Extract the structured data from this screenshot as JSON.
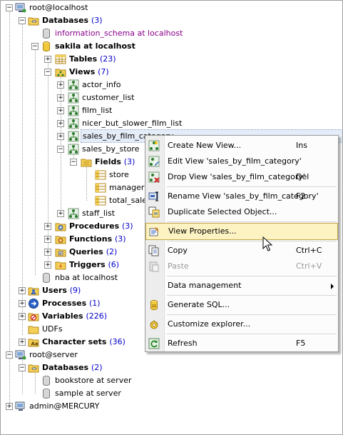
{
  "tree": {
    "root_localhost": "root@localhost",
    "databases": "Databases",
    "databases_count": "(3)",
    "information_schema": "information_schema at localhost",
    "sakila": "sakila at localhost",
    "tables": "Tables",
    "tables_count": "(23)",
    "views": "Views",
    "views_count": "(7)",
    "view_items": [
      "actor_info",
      "customer_list",
      "film_list",
      "nicer_but_slower_film_list",
      "sales_by_film_category",
      "sales_by_store"
    ],
    "fields": "Fields",
    "fields_count": "(3)",
    "field_items": [
      "store",
      "manager",
      "total_sales"
    ],
    "staff_list": "staff_list",
    "procedures": "Procedures",
    "procedures_count": "(3)",
    "functions": "Functions",
    "functions_count": "(3)",
    "queries": "Queries",
    "queries_count": "(2)",
    "triggers": "Triggers",
    "triggers_count": "(6)",
    "nba": "nba at localhost",
    "users": "Users",
    "users_count": "(9)",
    "processes": "Processes",
    "processes_count": "(1)",
    "variables": "Variables",
    "variables_count": "(226)",
    "udfs": "UDFs",
    "charsets": "Character sets",
    "charsets_count": "(36)",
    "root_server": "root@server",
    "server_databases": "Databases",
    "server_databases_count": "(2)",
    "bookstore": "bookstore at server",
    "sample": "sample at server",
    "admin_mercury": "admin@MERCURY"
  },
  "context_menu": {
    "create_view": {
      "label": "Create New View...",
      "shortcut": "Ins"
    },
    "edit_view": {
      "label": "Edit View 'sales_by_film_category'",
      "shortcut": ""
    },
    "drop_view": {
      "label": "Drop View 'sales_by_film_category'",
      "shortcut": "Del"
    },
    "rename_view": {
      "label": "Rename View 'sales_by_film_category'",
      "shortcut": "F2"
    },
    "duplicate": {
      "label": "Duplicate Selected Object...",
      "shortcut": ""
    },
    "view_properties": {
      "label": "View Properties...",
      "shortcut": ""
    },
    "copy": {
      "label": "Copy",
      "shortcut": "Ctrl+C"
    },
    "paste": {
      "label": "Paste",
      "shortcut": "Ctrl+V"
    },
    "data_management": {
      "label": "Data management",
      "shortcut": ""
    },
    "generate_sql": {
      "label": "Generate SQL...",
      "shortcut": ""
    },
    "customize": {
      "label": "Customize explorer...",
      "shortcut": ""
    },
    "refresh": {
      "label": "Refresh",
      "shortcut": "F5"
    }
  },
  "colors": {
    "count": "#0000cc",
    "schema": "#8b008b",
    "hover_bg": "#fdf3c2",
    "selection_bg": "#e4ecf7"
  }
}
